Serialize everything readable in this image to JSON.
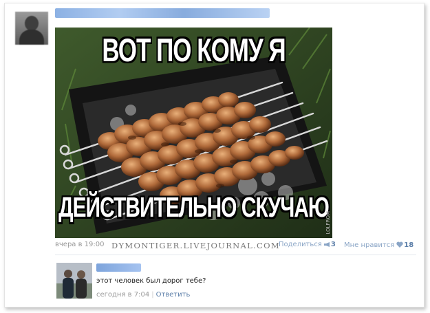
{
  "post": {
    "meme_top_text": "ВОТ ПО КОМУ Я",
    "meme_bottom_text": "ДЕЙСТВИТЕЛЬНО СКУЧАЮ",
    "image_corner_mark": "LOLFROM",
    "time": "вчера в 19:00",
    "site_watermark": "DYMONTIGER.LIVEJOURNAL.COM",
    "share_label": "Поделиться",
    "share_count": "3",
    "like_label": "Мне нравится",
    "like_count": "18"
  },
  "comment": {
    "text": "этот человек был дорог тебе?",
    "time": "сегодня в 7:04",
    "separator": "|",
    "reply_label": "Ответить"
  },
  "icons": {
    "share": "megaphone-icon",
    "like": "heart-icon"
  },
  "colors": {
    "link": "#5b7ea8",
    "muted": "#999999",
    "meme_text": "#ffffff"
  }
}
